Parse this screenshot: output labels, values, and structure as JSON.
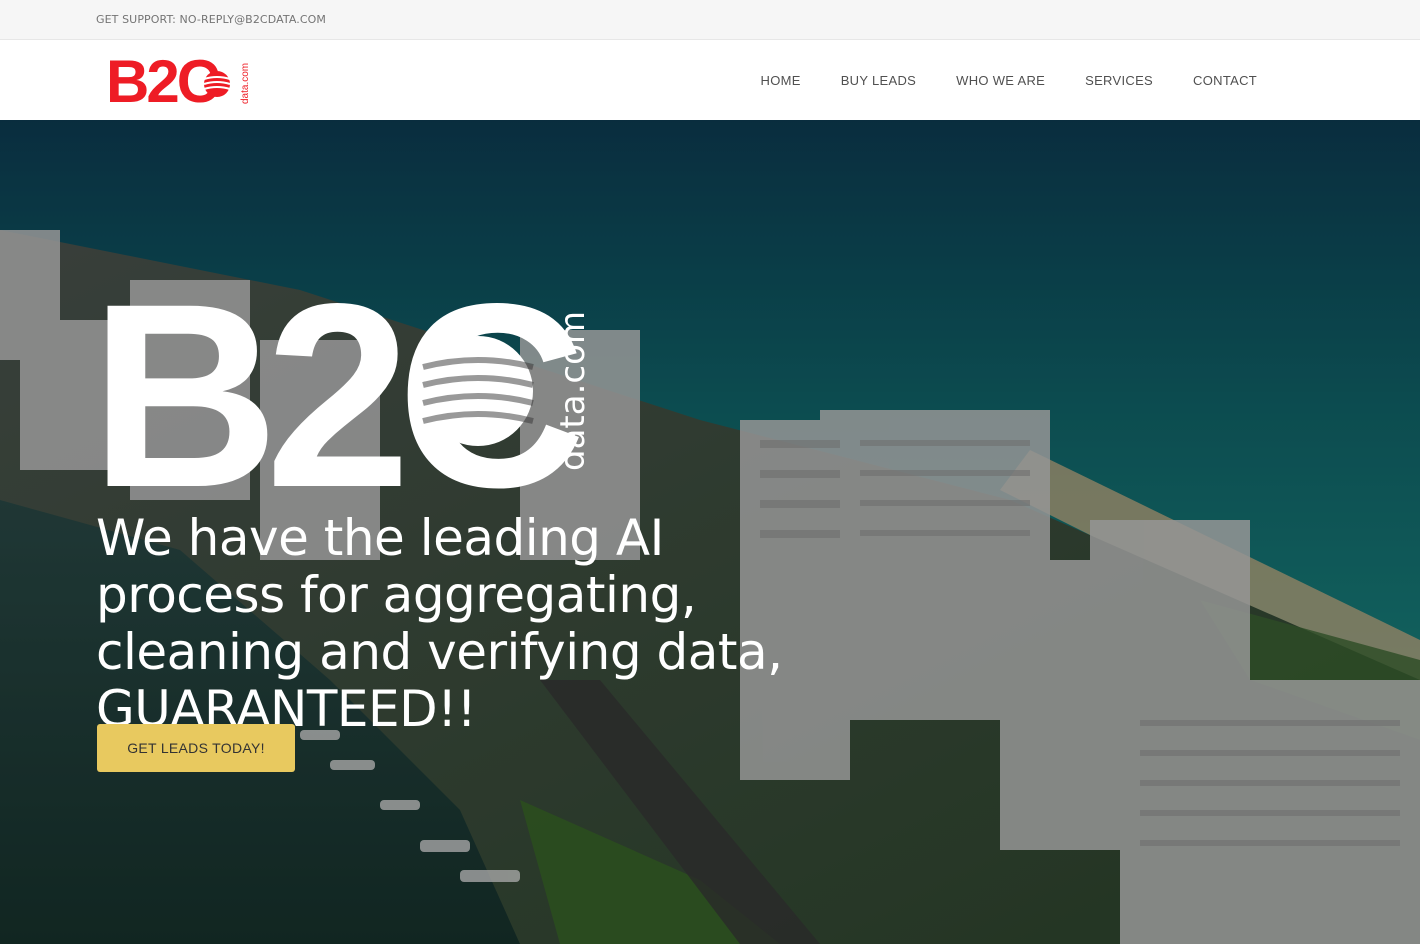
{
  "topbar": {
    "support_text": "GET SUPPORT: NO-REPLY@B2CDATA.COM"
  },
  "header": {
    "logo": {
      "text": "B2C",
      "domain": "data.com",
      "color": "#ee1c25"
    },
    "nav": [
      {
        "label": "HOME"
      },
      {
        "label": "BUY LEADS"
      },
      {
        "label": "WHO WE ARE"
      },
      {
        "label": "SERVICES"
      },
      {
        "label": "CONTACT"
      }
    ]
  },
  "hero": {
    "logo": {
      "text": "B2C",
      "domain": "data.com"
    },
    "headline": "We have the leading AI process for aggregating, cleaning and verifying data, GUARANTEED!!",
    "cta_label": "GET LEADS TODAY!",
    "cta_color": "#e8c95f",
    "background": "aerial-coastline-photo"
  }
}
